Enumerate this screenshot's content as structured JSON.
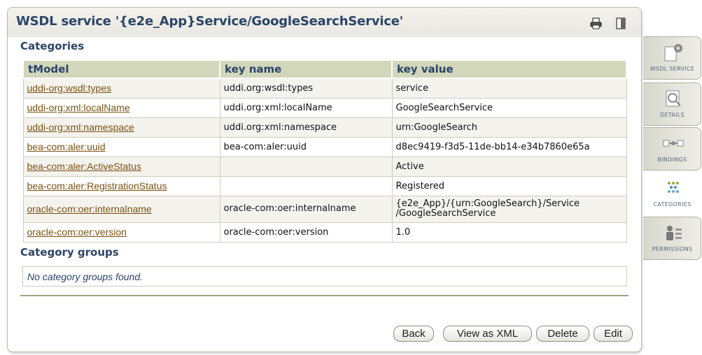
{
  "header": {
    "title": "WSDL service '{e2e_App}Service/GoogleSearchService'"
  },
  "sections": {
    "categories": "Categories",
    "category_groups": "Category groups"
  },
  "table": {
    "columns": [
      "tModel",
      "key name",
      "key value"
    ],
    "rows": [
      {
        "tmodel": "uddi-org:wsdl:types",
        "key_name": "uddi.org:wsdl:types",
        "key_value": "service"
      },
      {
        "tmodel": "uddi-org:xml:localName",
        "key_name": "uddi.org:xml:localName",
        "key_value": "GoogleSearchService"
      },
      {
        "tmodel": "uddi-org:xml:namespace",
        "key_name": "uddi.org:xml:namespace",
        "key_value": "urn:GoogleSearch"
      },
      {
        "tmodel": "bea-com:aler:uuid",
        "key_name": "bea-com:aler:uuid",
        "key_value": "d8ec9419-f3d5-11de-bb14-e34b7860e65a"
      },
      {
        "tmodel": "bea-com:aler:ActiveStatus",
        "key_name": "",
        "key_value": "Active"
      },
      {
        "tmodel": "bea-com:aler:RegistrationStatus",
        "key_name": "",
        "key_value": "Registered"
      },
      {
        "tmodel": "oracle-com:oer:internalname",
        "key_name": "oracle-com:oer:internalname",
        "key_value_line1": "{e2e_App}/{urn:GoogleSearch}/Service",
        "key_value_line2": "/GoogleSearchService"
      },
      {
        "tmodel": "oracle-com:oer:version",
        "key_name": "oracle-com:oer:version",
        "key_value": "1.0"
      }
    ]
  },
  "groups": {
    "empty_message": "No category groups found."
  },
  "buttons": {
    "back": "Back",
    "view_xml": "View as XML",
    "delete": "Delete",
    "edit": "Edit"
  },
  "tabs": [
    {
      "label": "WSDL SERVICE",
      "icon": "wsdl-service-icon",
      "active": false
    },
    {
      "label": "DETAILS",
      "icon": "details-icon",
      "active": false
    },
    {
      "label": "BINDINGS",
      "icon": "bindings-icon",
      "active": false
    },
    {
      "label": "CATEGORIES",
      "icon": "categories-icon",
      "active": true
    },
    {
      "label": "PERMISSIONS",
      "icon": "permissions-icon",
      "active": false
    }
  ],
  "colors": {
    "title": "#2b4568",
    "link": "#7a5212",
    "header_row": "#d2d7bb",
    "divider": "#9ea781"
  }
}
